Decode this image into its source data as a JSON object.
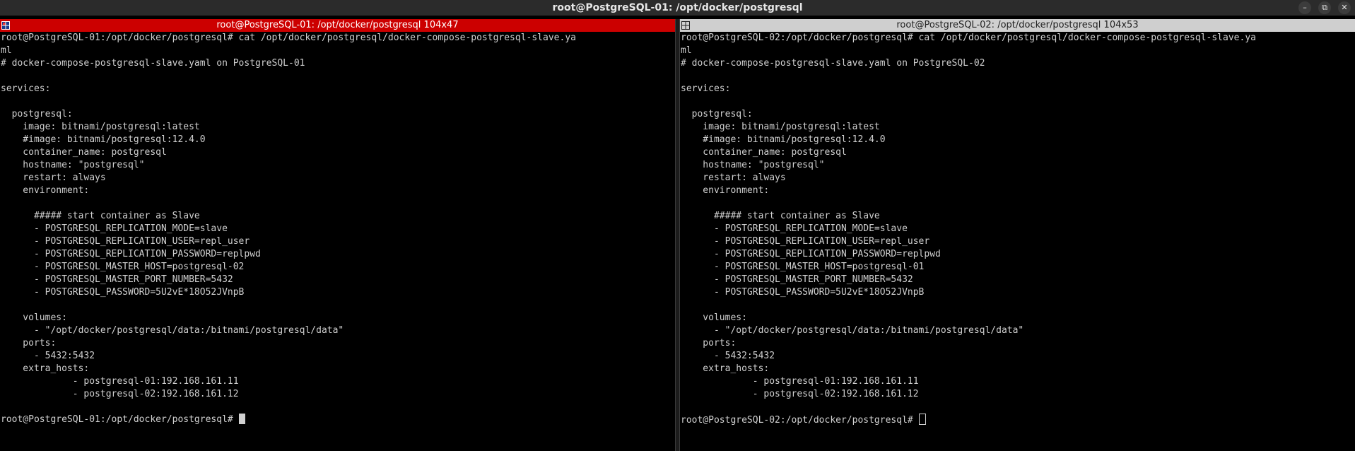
{
  "window": {
    "title": "root@PostgreSQL-01: /opt/docker/postgresql",
    "controls": [
      "minimize-icon",
      "restore-icon",
      "close-icon"
    ]
  },
  "panes": [
    {
      "header": "root@PostgreSQL-01: /opt/docker/postgresql 104x47",
      "header_color": "#cc0000",
      "icon": "split-pane-icon",
      "lines": [
        "root@PostgreSQL-01:/opt/docker/postgresql# cat /opt/docker/postgresql/docker-compose-postgresql-slave.ya",
        "ml",
        "# docker-compose-postgresql-slave.yaml on PostgreSQL-01",
        "",
        "services:",
        "",
        "  postgresql:",
        "    image: bitnami/postgresql:latest",
        "    #image: bitnami/postgresql:12.4.0",
        "    container_name: postgresql",
        "    hostname: \"postgresql\"",
        "    restart: always",
        "    environment:",
        "",
        "      ##### start container as Slave",
        "      - POSTGRESQL_REPLICATION_MODE=slave",
        "      - POSTGRESQL_REPLICATION_USER=repl_user",
        "      - POSTGRESQL_REPLICATION_PASSWORD=replpwd",
        "      - POSTGRESQL_MASTER_HOST=postgresql-02",
        "      - POSTGRESQL_MASTER_PORT_NUMBER=5432",
        "      - POSTGRESQL_PASSWORD=5U2vE*18O52JVnpB",
        "",
        "    volumes:",
        "      - \"/opt/docker/postgresql/data:/bitnami/postgresql/data\"",
        "    ports:",
        "      - 5432:5432",
        "    extra_hosts:",
        "             - postgresql-01:192.168.161.11",
        "             - postgresql-02:192.168.161.12",
        ""
      ],
      "prompt": "root@PostgreSQL-01:/opt/docker/postgresql# ",
      "cursor": "block"
    },
    {
      "header": "root@PostgreSQL-02: /opt/docker/postgresql 104x53",
      "header_color": "#cfcfcf",
      "icon": "split-pane-icon",
      "lines": [
        "root@PostgreSQL-02:/opt/docker/postgresql# cat /opt/docker/postgresql/docker-compose-postgresql-slave.ya",
        "ml",
        "# docker-compose-postgresql-slave.yaml on PostgreSQL-02",
        "",
        "services:",
        "",
        "  postgresql:",
        "    image: bitnami/postgresql:latest",
        "    #image: bitnami/postgresql:12.4.0",
        "    container_name: postgresql",
        "    hostname: \"postgresql\"",
        "    restart: always",
        "    environment:",
        "",
        "      ##### start container as Slave",
        "      - POSTGRESQL_REPLICATION_MODE=slave",
        "      - POSTGRESQL_REPLICATION_USER=repl_user",
        "      - POSTGRESQL_REPLICATION_PASSWORD=replpwd",
        "      - POSTGRESQL_MASTER_HOST=postgresql-01",
        "      - POSTGRESQL_MASTER_PORT_NUMBER=5432",
        "      - POSTGRESQL_PASSWORD=5U2vE*18O52JVnpB",
        "",
        "    volumes:",
        "      - \"/opt/docker/postgresql/data:/bitnami/postgresql/data\"",
        "    ports:",
        "      - 5432:5432",
        "    extra_hosts:",
        "             - postgresql-01:192.168.161.11",
        "             - postgresql-02:192.168.161.12",
        ""
      ],
      "prompt": "root@PostgreSQL-02:/opt/docker/postgresql# ",
      "cursor": "hollow"
    }
  ]
}
